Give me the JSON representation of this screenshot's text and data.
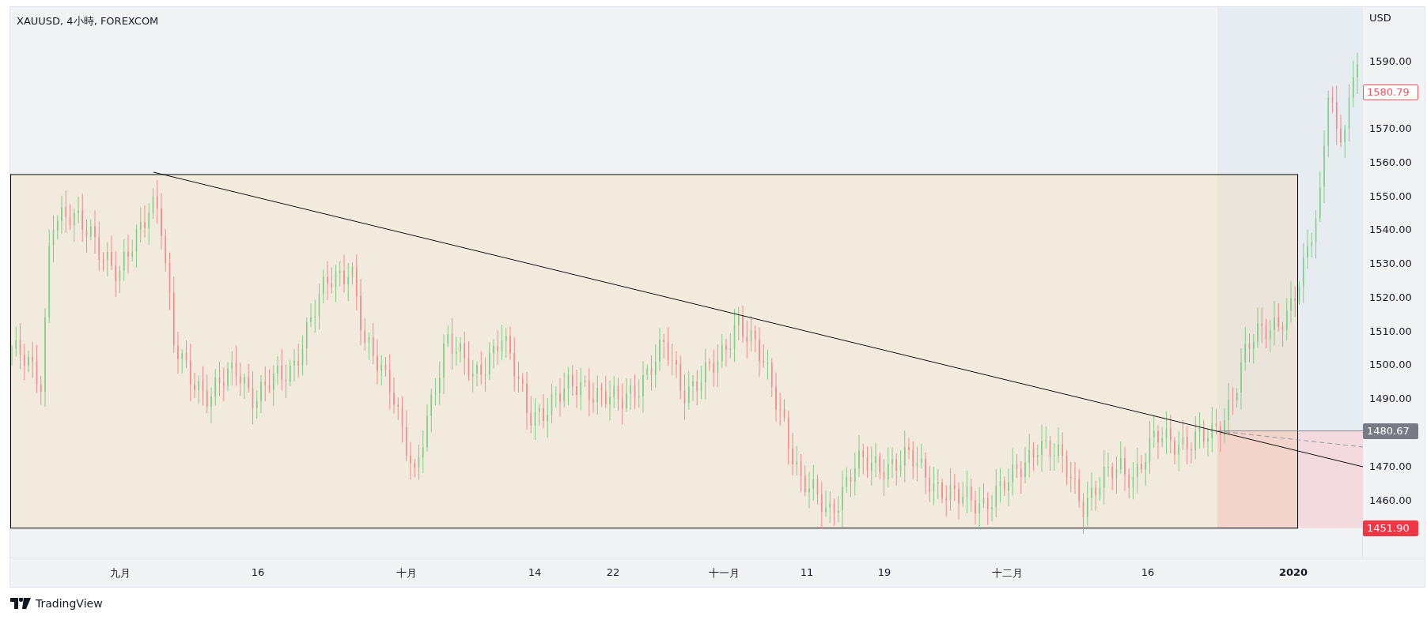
{
  "chart": {
    "legend": "XAUUSD, 4小時, FOREXCOM",
    "currency": "USD",
    "price_labels": [
      "1590.00",
      "1570.00",
      "1560.00",
      "1550.00",
      "1540.00",
      "1530.00",
      "1520.00",
      "1510.00",
      "1500.00",
      "1490.00",
      "1470.00",
      "1460.00"
    ],
    "price_tags": [
      {
        "kind": "last",
        "text": "1580.79"
      },
      {
        "kind": "entry",
        "text": "1480.67"
      },
      {
        "kind": "stop",
        "text": "1451.90"
      }
    ],
    "time_labels": [
      {
        "text": "九月",
        "bold": false
      },
      {
        "text": "16",
        "bold": false
      },
      {
        "text": "十月",
        "bold": false
      },
      {
        "text": "14",
        "bold": false
      },
      {
        "text": "22",
        "bold": false
      },
      {
        "text": "十一月",
        "bold": false
      },
      {
        "text": "11",
        "bold": false
      },
      {
        "text": "19",
        "bold": false
      },
      {
        "text": "十二月",
        "bold": false
      },
      {
        "text": "16",
        "bold": false
      },
      {
        "text": "2020",
        "bold": true
      }
    ]
  },
  "branding": {
    "name": "TradingView"
  }
}
